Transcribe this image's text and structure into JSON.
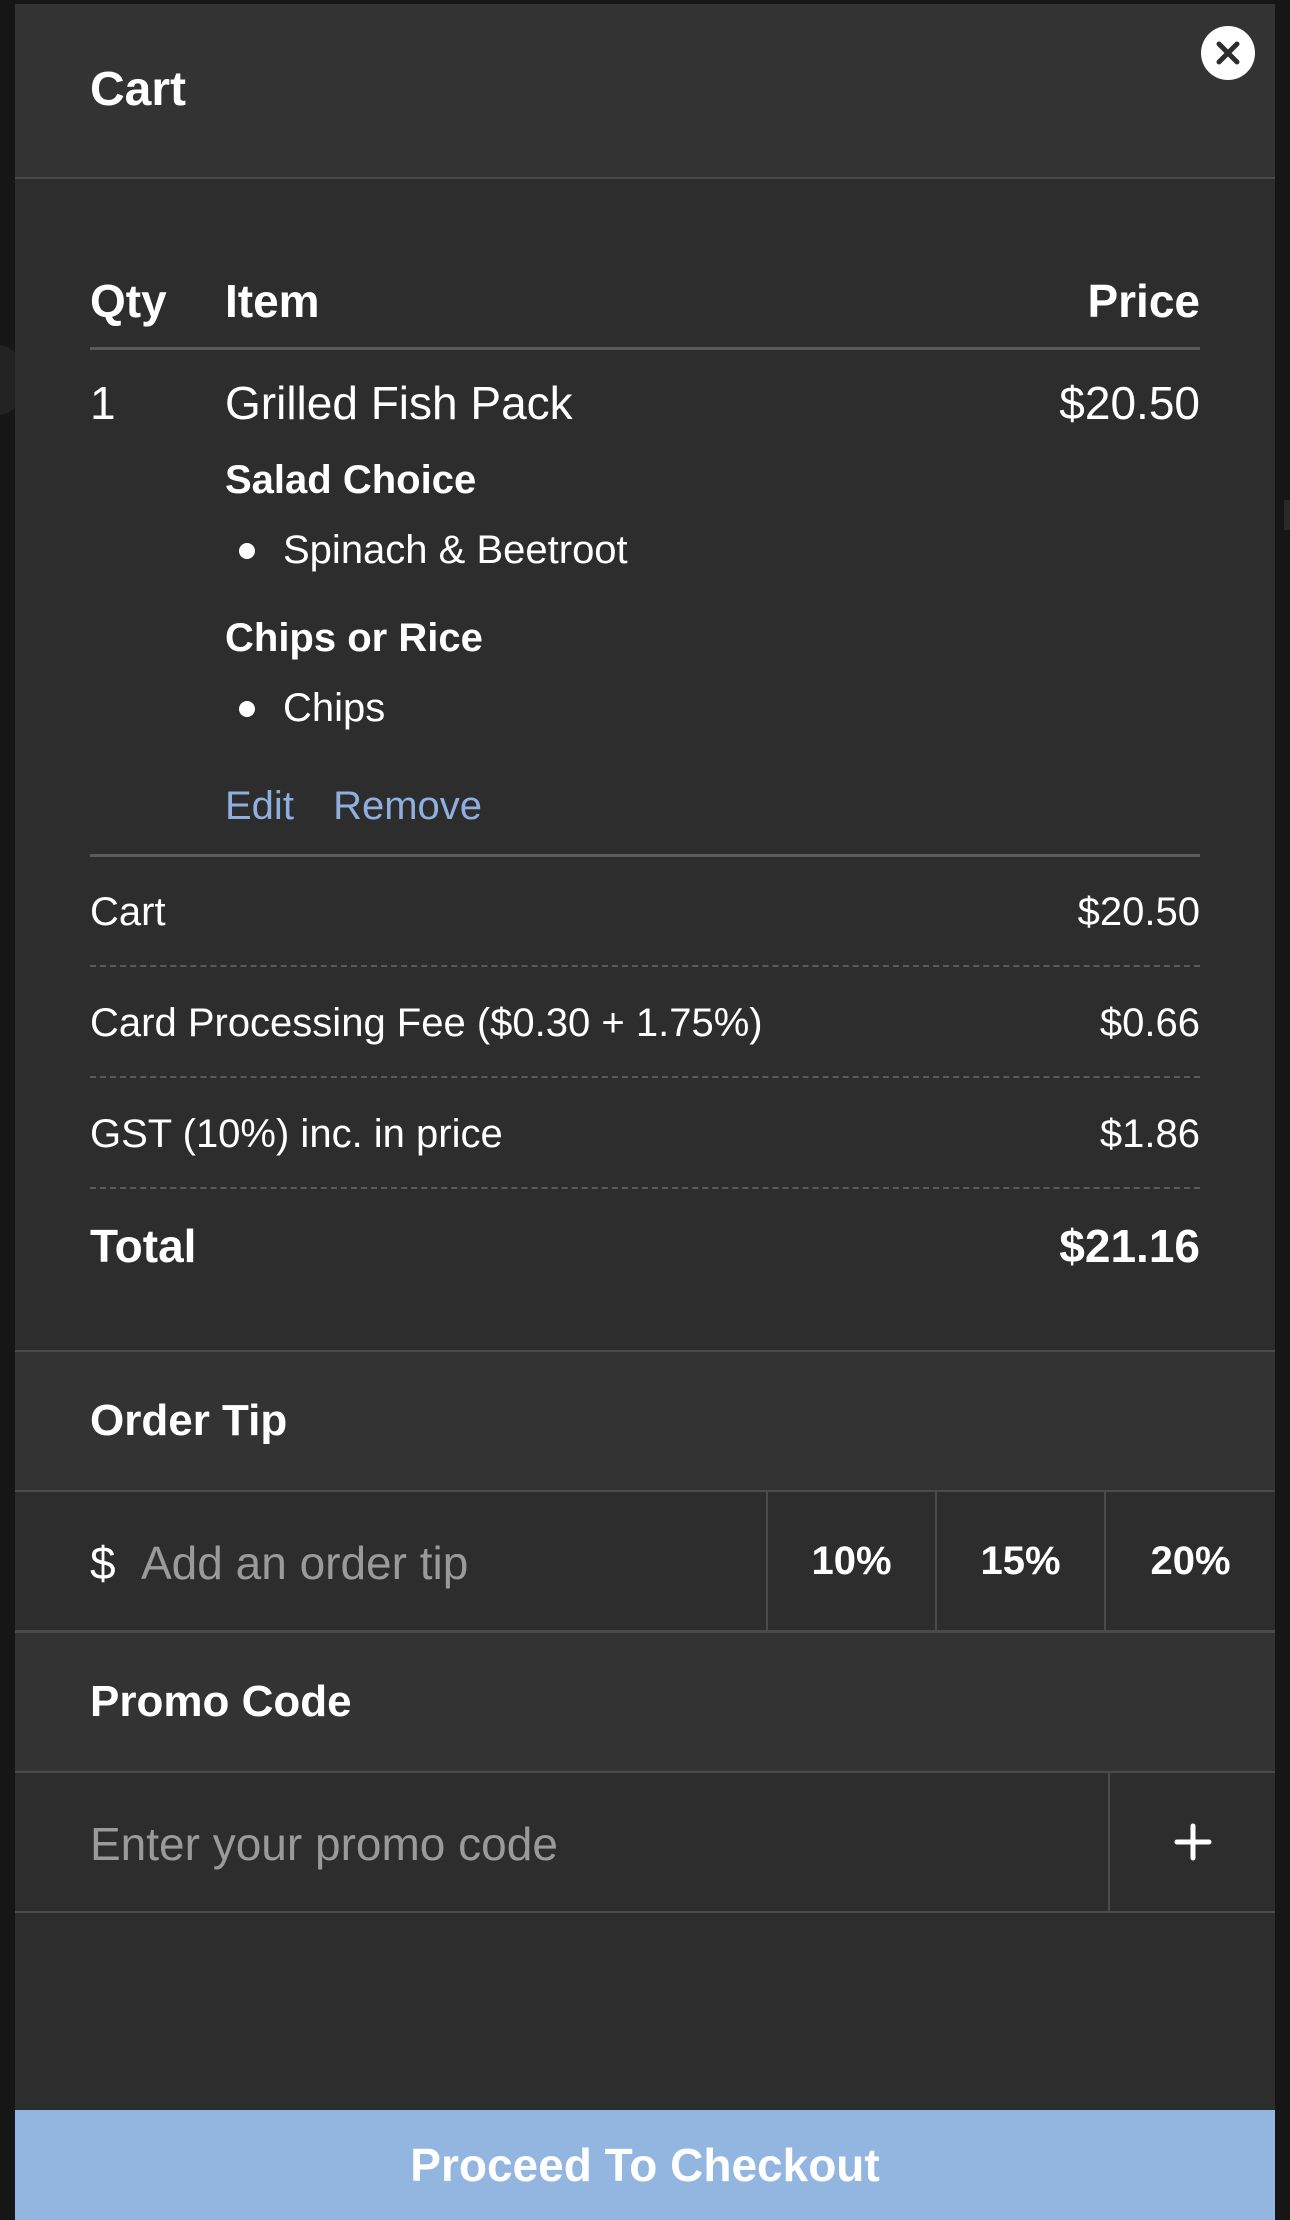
{
  "cart": {
    "title": "Cart",
    "close_icon": "close-icon",
    "columns": {
      "qty": "Qty",
      "item": "Item",
      "price": "Price"
    },
    "items": [
      {
        "qty": "1",
        "name": "Grilled Fish Pack",
        "price": "$20.50",
        "options": [
          {
            "group": "Salad Choice",
            "value": "Spinach & Beetroot"
          },
          {
            "group": "Chips or Rice",
            "value": "Chips"
          }
        ],
        "edit_label": "Edit",
        "remove_label": "Remove"
      }
    ],
    "summary": {
      "cart_label": "Cart",
      "cart_value": "$20.50",
      "fee_label": "Card Processing Fee ($0.30 + 1.75%)",
      "fee_value": "$0.66",
      "gst_label": "GST (10%) inc. in price",
      "gst_value": "$1.86",
      "total_label": "Total",
      "total_value": "$21.16"
    }
  },
  "tip": {
    "title": "Order Tip",
    "currency": "$",
    "placeholder": "Add an order tip",
    "options": [
      "10%",
      "15%",
      "20%"
    ]
  },
  "promo": {
    "title": "Promo Code",
    "placeholder": "Enter your promo code",
    "add_icon": "plus-icon"
  },
  "checkout": {
    "label": "Proceed To Checkout"
  },
  "colors": {
    "panel_bg": "#2d2d2d",
    "header_bg": "#333333",
    "link": "#8fb0de",
    "checkout_bg": "#93b6e1"
  }
}
